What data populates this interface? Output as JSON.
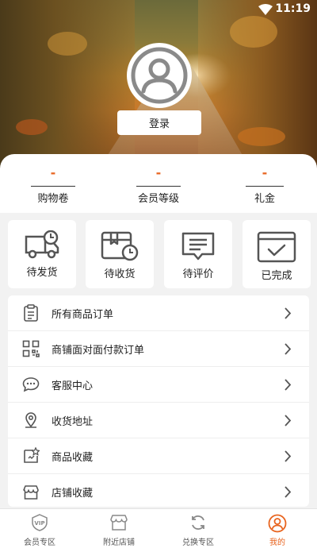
{
  "status": {
    "time": "11:19"
  },
  "profile": {
    "login_label": "登录"
  },
  "stats": [
    {
      "value": "-",
      "label": "购物卷"
    },
    {
      "value": "-",
      "label": "会员等级"
    },
    {
      "value": "-",
      "label": "礼金"
    }
  ],
  "order_status": [
    {
      "label": "待发货",
      "icon": "truck-icon"
    },
    {
      "label": "待收货",
      "icon": "package-clock-icon"
    },
    {
      "label": "待评价",
      "icon": "comment-icon"
    },
    {
      "label": "已完成",
      "icon": "calendar-check-icon"
    }
  ],
  "menu": [
    {
      "label": "所有商品订单",
      "icon": "clipboard-icon"
    },
    {
      "label": "商铺面对面付款订单",
      "icon": "qrcode-icon"
    },
    {
      "label": "客服中心",
      "icon": "chat-icon"
    },
    {
      "label": "收货地址",
      "icon": "location-icon"
    },
    {
      "label": "商品收藏",
      "icon": "favorite-goods-icon"
    },
    {
      "label": "店铺收藏",
      "icon": "store-icon"
    }
  ],
  "tabs": [
    {
      "label": "会员专区",
      "icon": "vip-icon",
      "active": false
    },
    {
      "label": "附近店铺",
      "icon": "shop-icon",
      "active": false
    },
    {
      "label": "兑换专区",
      "icon": "exchange-icon",
      "active": false
    },
    {
      "label": "我的",
      "icon": "user-icon",
      "active": true
    }
  ],
  "colors": {
    "accent": "#e8641f",
    "icon_gray": "#555555"
  }
}
